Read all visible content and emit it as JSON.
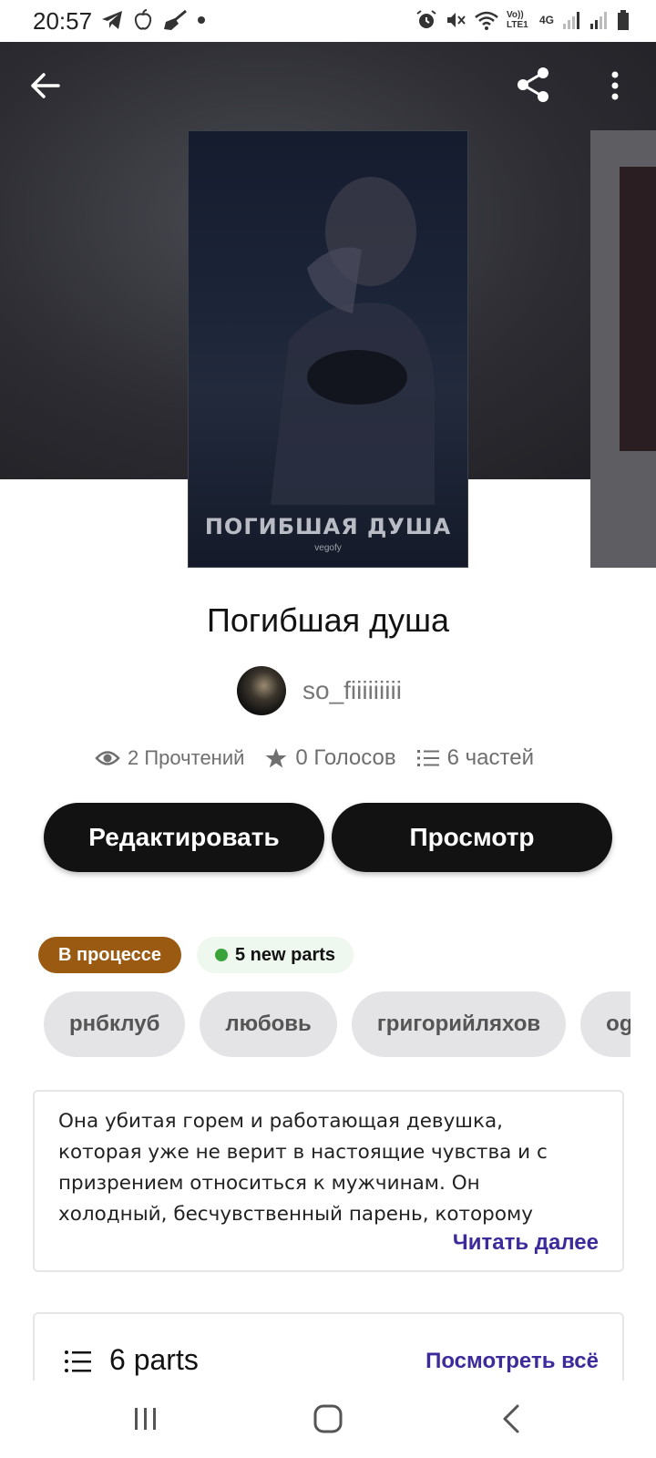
{
  "status_bar": {
    "time": "20:57",
    "left_icons": [
      "telegram-icon",
      "apple-icon",
      "broom-icon",
      "dot-icon"
    ],
    "right_icons": [
      "alarm-icon",
      "mute-icon",
      "wifi-icon",
      "volte-icon",
      "4g-icon",
      "signal-icon",
      "signal-icon",
      "battery-icon"
    ],
    "volte_label": "Vo)) LTE1",
    "net_label": "4G"
  },
  "cover": {
    "title": "ПОГИБШАЯ ДУША",
    "author": "vegofy"
  },
  "story": {
    "title": "Погибшая душа",
    "author": "so_fiiiiiiiii",
    "reads": "2 Прочтений",
    "votes": "0 Голосов",
    "parts": "6 частей"
  },
  "actions": {
    "edit_label": "Редактировать",
    "preview_label": "Просмотр"
  },
  "badges": {
    "status": "В процессе",
    "new_parts": "5 new parts"
  },
  "tags": [
    "рнбклуб",
    "любовь",
    "григорийляхов",
    "ogbuda"
  ],
  "description": {
    "text": "Она убитая горем и работающая девушка, которая уже не верит в настоящие чувства и с призрением относиться к мужчинам. Он холодный, бесчувственный парень, которому",
    "read_more": "Читать далее"
  },
  "parts_section": {
    "count_label": "6 parts",
    "see_all": "Посмотреть всё"
  },
  "colors": {
    "status_badge": "#9a5a12",
    "link": "#3d2a9b",
    "button": "#121212"
  }
}
